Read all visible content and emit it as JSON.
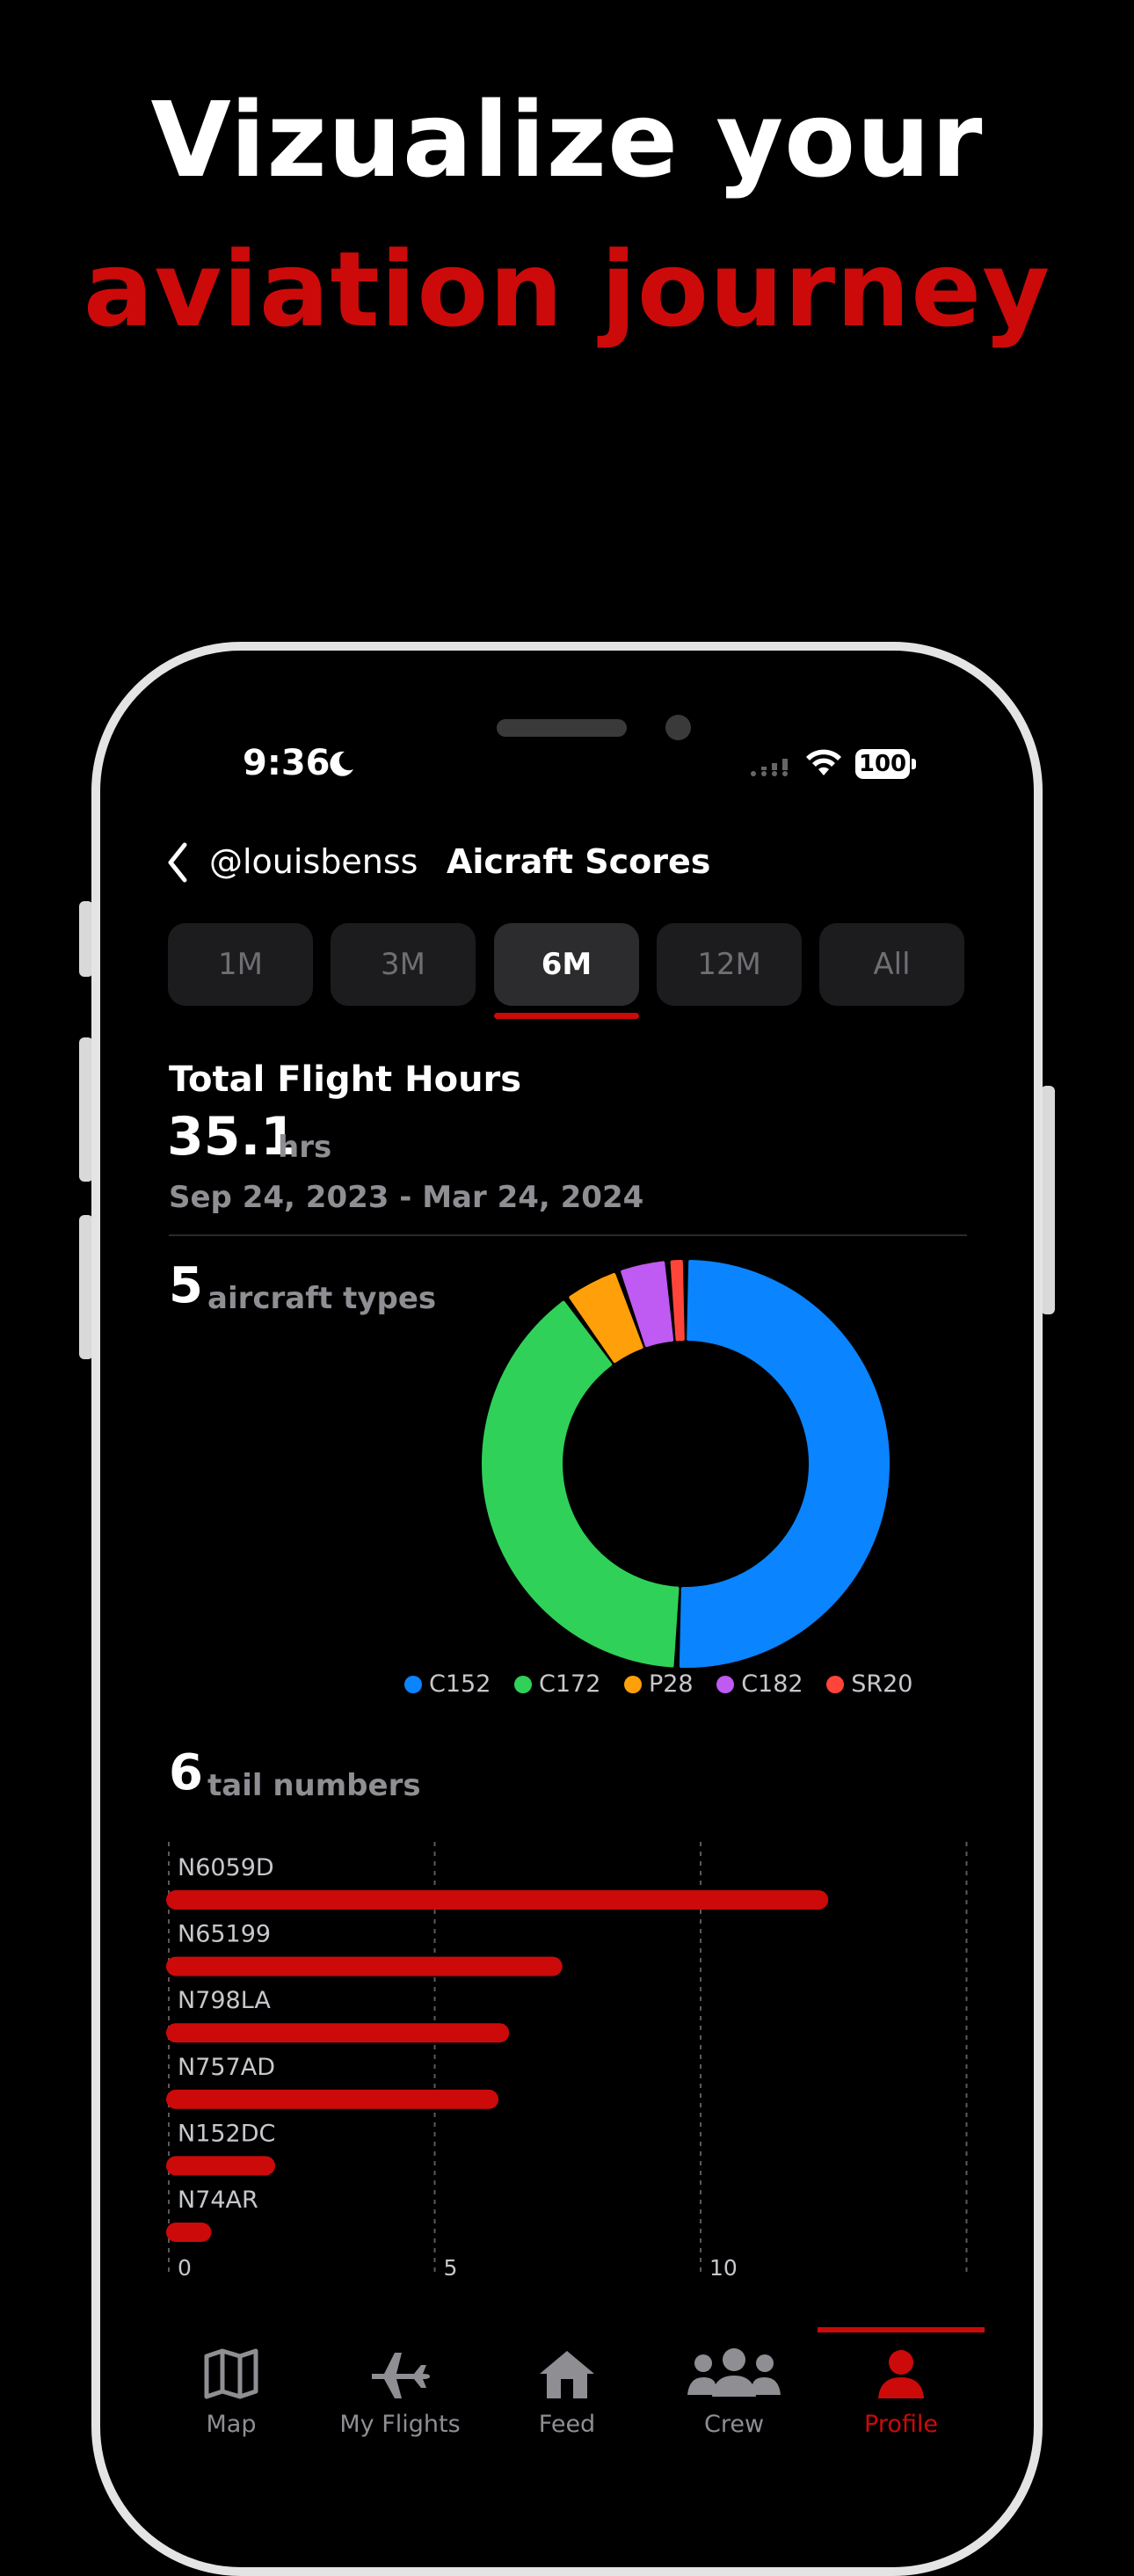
{
  "headline": {
    "line1": "Vizualize your",
    "line2": "aviation journey"
  },
  "status_bar": {
    "time": "9:36",
    "battery": "100"
  },
  "nav": {
    "back_user": "@louisbenss",
    "title": "Aicraft Scores"
  },
  "segments": [
    {
      "label": "1M"
    },
    {
      "label": "3M"
    },
    {
      "label": "6M",
      "active": true
    },
    {
      "label": "12M"
    },
    {
      "label": "All"
    }
  ],
  "total": {
    "label": "Total Flight Hours",
    "value": "35.1",
    "unit": "hrs",
    "range": "Sep 24, 2023 - Mar 24, 2024"
  },
  "aircraft": {
    "count": "5",
    "label": "aircraft types"
  },
  "tails": {
    "count": "6",
    "label": "tail numbers"
  },
  "colors": {
    "accent": "#cc0a0a",
    "c152": "#0a84ff",
    "c172": "#30d158",
    "p28": "#ff9f0a",
    "c182": "#bf5af2",
    "sr20": "#ff453a"
  },
  "chart_data": [
    {
      "type": "pie",
      "categories": [
        "C152",
        "C172",
        "P28",
        "C182",
        "SR20"
      ],
      "values": [
        17.8,
        13.8,
        1.6,
        1.4,
        0.5
      ],
      "colors": [
        "#0a84ff",
        "#30d158",
        "#ff9f0a",
        "#bf5af2",
        "#ff453a"
      ],
      "legend_placement": "bottom"
    },
    {
      "type": "bar",
      "orientation": "horizontal",
      "categories": [
        "N6059D",
        "N65199",
        "N798LA",
        "N757AD",
        "N152DC",
        "N74AR"
      ],
      "values": [
        12.4,
        7.4,
        6.4,
        6.2,
        2.0,
        0.8
      ],
      "xticks": [
        "0",
        "5",
        "10"
      ],
      "xlim": [
        0,
        15
      ],
      "grid": true
    }
  ],
  "tabs": [
    {
      "label": "Map",
      "icon": "map-icon"
    },
    {
      "label": "My Flights",
      "icon": "airplane-icon"
    },
    {
      "label": "Feed",
      "icon": "house-icon"
    },
    {
      "label": "Crew",
      "icon": "people-icon"
    },
    {
      "label": "Profile",
      "icon": "person-icon",
      "active": true
    }
  ]
}
